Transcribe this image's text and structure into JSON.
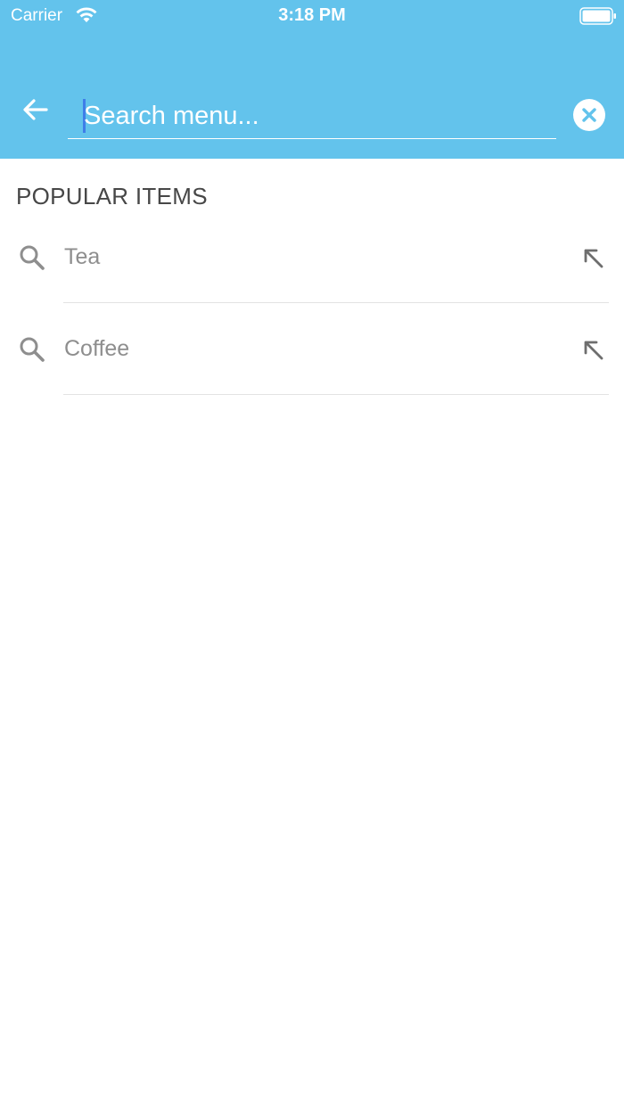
{
  "status_bar": {
    "carrier": "Carrier",
    "time": "3:18 PM",
    "wifi_icon": "wifi-icon",
    "battery_icon": "battery-icon"
  },
  "header": {
    "background_color": "#63c3ec",
    "back_icon": "arrow-left-icon",
    "search": {
      "placeholder": "Search menu...",
      "value": ""
    },
    "clear_icon": "close-circle-icon"
  },
  "popular": {
    "title": "POPULAR ITEMS",
    "items": [
      {
        "label": "Tea",
        "icon": "search-icon",
        "action_icon": "arrow-up-left-icon"
      },
      {
        "label": "Coffee",
        "icon": "search-icon",
        "action_icon": "arrow-up-left-icon"
      }
    ]
  }
}
